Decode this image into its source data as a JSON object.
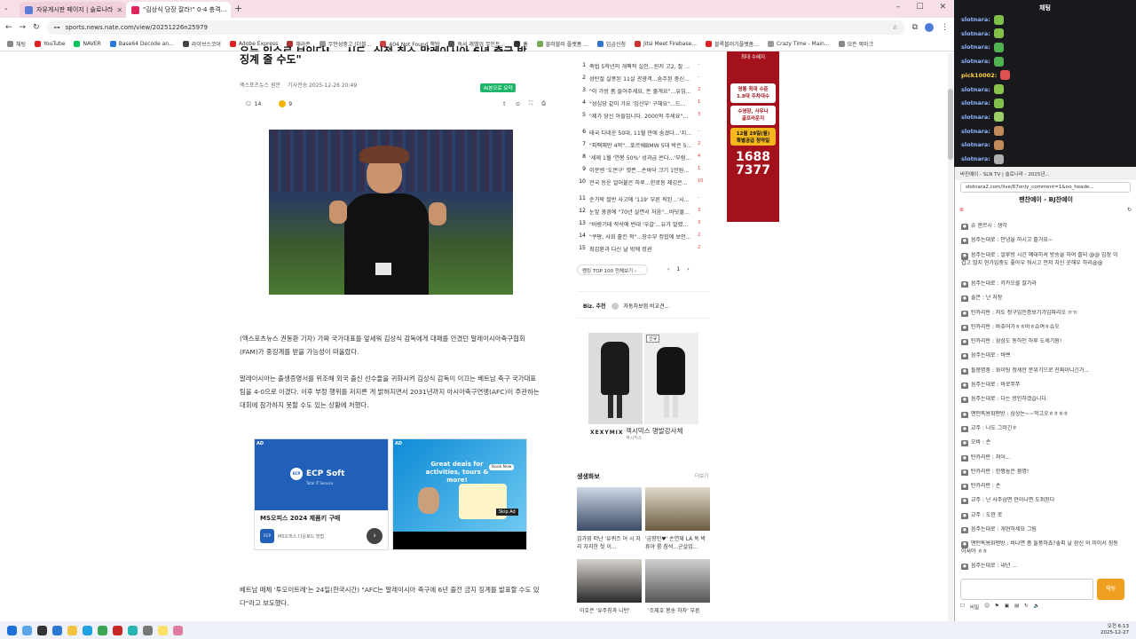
{
  "tabs": [
    {
      "label": "자유게시판 페이지 | 슬로나라"
    },
    {
      "label": "\"김상식 당장 잘라!\" 0-4 충격..."
    }
  ],
  "address": "sports.news.nate.com/view/20251226n25979",
  "bookmarks": [
    "채팅",
    "YouTube",
    "NAVER",
    "Base64 Decode an...",
    "라이브스코어",
    "Adobe Express",
    "채라존",
    "무안성중고 (더블...",
    "404 Not Found 책방",
    "독서 레벨업 무인트...",
    "홈",
    "블러블러 플랫폼 ...",
    "입금신청",
    "Jitsi Meet Firebase...",
    "블록블러기플랫폼...",
    "Crazy Time - Main...",
    "모든 북마크"
  ],
  "article": {
    "title_line1": "우는 일수로 보인다!... 시도, 실점 취소 말레이시아 6년 출국 방",
    "title_line2": "징계 줄 수도\"",
    "press": "엑스포츠뉴스 원문",
    "date": "기사전송 2025-12-26 20:49",
    "comments": "14",
    "likes": "9",
    "ai_badge": "AI본으로 요약",
    "p1": "(엑스포츠뉴스 권동환 기자) 가짜 국가대표를 앞세워 김상식 감독에게 대패를 안겼던 말레이시아축구협회(FAM)가 중징계를 받을 가능성이 떠올랐다.",
    "p2": "말레이시아는 출생증명서를 위조해 외국 출신 선수들을 귀화시켜 김상식 감독이 이끄는 베트남 축구 국가대표팀을 4-0으로 이겼다. 이후 부정 행위를 저지른 게 밝혀지면서 2031년까지 아시아축구연맹(AFC)이 주관하는 대회에 참가하지 못할 수도 있는 상황에 처했다.",
    "p3": "베트남 매체 '투오이트레'는 24일(한국시간) \"AFC는 말레이시아 축구에 6년 출전 금지 징계를 발표할 수도 있다\"라고 보도했다."
  },
  "ads": [
    {
      "tag": "AD",
      "brand": "ECP Soft",
      "sub": "Total IT Service",
      "headline": "MS오피스 2024 제품키 구매",
      "desc": "MS오피스 다운로드 방법"
    },
    {
      "tag": "AD",
      "headline": "Great deals for activities, tours & more!",
      "cta": "Book Now",
      "skip": "Skip Ad"
    }
  ],
  "ranking": [
    {
      "n": "1",
      "t": "축법 5학년의 개팩적 실인...윈저 고2, 잘 ...",
      "d": "–"
    },
    {
      "n": "2",
      "t": "성탄절 실종된 11살 관광객...숨주된 중신...",
      "d": "–"
    },
    {
      "n": "3",
      "t": "\"이 가방 좀 들어주세요, 돈 줄게요\"...유입...",
      "d": "2"
    },
    {
      "n": "4",
      "t": "\"성심당 같이 가요 '임산부' 구해요\"...드...",
      "d": "1"
    },
    {
      "n": "5",
      "t": "\"제가 당신 아들입니다. 2000억 주세요\"...",
      "d": "3"
    },
    {
      "n": "6",
      "t": "태국 디네운 50대, 11월 만에 숨겼다...'지...",
      "d": "–"
    },
    {
      "n": "7",
      "t": "\"피팩해만 4억\"...포르쉐BMW 5대 박은 5...",
      "d": "2"
    },
    {
      "n": "8",
      "t": "'세제 1월 '연봉 50%' 성과급 쏜다...'부럼...",
      "d": "4"
    },
    {
      "n": "9",
      "t": "이분엔 '도몬구' 엿픈...손바닥 크기 1만원...",
      "d": "1"
    },
    {
      "n": "10",
      "t": "전국 등운 얼어붙은 하루...한로동 제깅은...",
      "d": "10"
    },
    {
      "n": "11",
      "t": "순가락 절반 사고에 '119' 부른 직된...'시...",
      "d": "–"
    },
    {
      "n": "12",
      "t": "눈앞 광경에 \"70년 살면서 처음\"...바닷물...",
      "d": "3"
    },
    {
      "n": "13",
      "t": "\"바람기테 작석에 번대 '우갈'...유가 말렸...",
      "d": "3"
    },
    {
      "n": "14",
      "t": "\"쿠팡, 사회 흩킨 적\"...장수부 정합에 보안...",
      "d": "2"
    },
    {
      "n": "15",
      "t": "최갑환과 다신 날 밖에 정권",
      "d": "2"
    }
  ],
  "ranking_more": "랭킹 TOP 100 전체보기",
  "ranking_page": "1",
  "biz": {
    "label": "Biz. 추천",
    "item": "자동차보험 비교견..."
  },
  "shop": {
    "brand": "XEXYMIX",
    "name": "젝시믹스 명발강사체",
    "sub": "젝시믹스",
    "tag": "신규"
  },
  "photonews": {
    "title": "생생화보",
    "more": "더보기",
    "items": [
      "김가영 떠난 '유퀴즈 어 시 자리 차지한 첫 이...",
      "'금향인♥' 손연재 LA 독 박휴야 룸 참석...군살업...",
      "이호은 '유주칭과 니턴'",
      "'조제호 봉송 하자' 부른"
    ]
  },
  "banner": {
    "l1": "최대 수혜지",
    "l2": "영통 최대 수준",
    "l3": "1.9대 주차대수",
    "l4": "수영장, 사우나",
    "l5": "골프라운지",
    "l6": "12월 29일(월)",
    "l7": "특별공급 청약일",
    "phone1": "1688",
    "phone2": "7377"
  },
  "chat": {
    "title": "채팅",
    "lines": [
      {
        "u": "slotnara:"
      },
      {
        "u": "slotnara:"
      },
      {
        "u": "slotnara:"
      },
      {
        "u": "slotnara:"
      },
      {
        "u": "pick10002:"
      },
      {
        "u": "slotnara:"
      },
      {
        "u": "slotnara:"
      },
      {
        "u": "slotnara:"
      },
      {
        "u": "slotnara:"
      },
      {
        "u": "slotnara:"
      },
      {
        "u": "slotnara:"
      },
      {
        "u": "slotnara:"
      }
    ]
  },
  "popup": {
    "window_title": "바진예이 - SLN TV | 슬로나라 - 2025년...",
    "url": "slotnara2.com/live/67only_comment=1&no_heade...",
    "header": "팬찬예이 - BJ찬예이",
    "send": "채팅",
    "status": "비밀",
    "messages": [
      "슈 엔르시 : 생각",
      "음주는대로 : 안녕을 하시고 즐거요~",
      "음주는대로 : 얼루방 시간 예대하셔 방송을 하여 즐되 @@ 입장 이겁고 많지 현가입중도 좋아우 워시고 먼저 치신 곳해우 하리@@",
      "음주는대로 : 카카오를 잘가라",
      "솔은 : 난 처장",
      "탄카리란 : 저도 청구입인증보기가입파리오 ㅠㅠ",
      "탄카리란 : 바츄어가ㅎㅎ바ㅎ슈여ㅎ슈오",
      "탄카리란 : 삼삼도 동하인 하루 도세기원!",
      "음주는대로 : 바쁘",
      "틀봉명충 : 화이팅 정세한 분위기으로 진짜이니긴가...",
      "음주는대로 : 바로쭈쭈",
      "음주는대로 : 다는 방인하겠습니다.",
      "맨떤똑용화맨방 : 삼상논~~먹고오ㅎㅎㅎㅎ",
      "교주 : 나도 그러긴ㅎ",
      "오바 : 손",
      "탄카리란 : 쳐어...",
      "탄카리란 : 한짱높은 붐명!",
      "탄카리란 : 손",
      "교주 : 난 사주삼면 한이니면 도취된다",
      "교주 : 도한 로",
      "음주는대로 : 개현하세요 그림",
      "맨떤똑용화맨방 : 비냐면 좀 들풍하죠?좋피 날 장신 의 미이서 칭동이셔야 ㅎㅎ",
      "음주는대로 : 내년 ..."
    ]
  },
  "clock": {
    "time": "오전 6:13",
    "date": "2025-12-27"
  }
}
